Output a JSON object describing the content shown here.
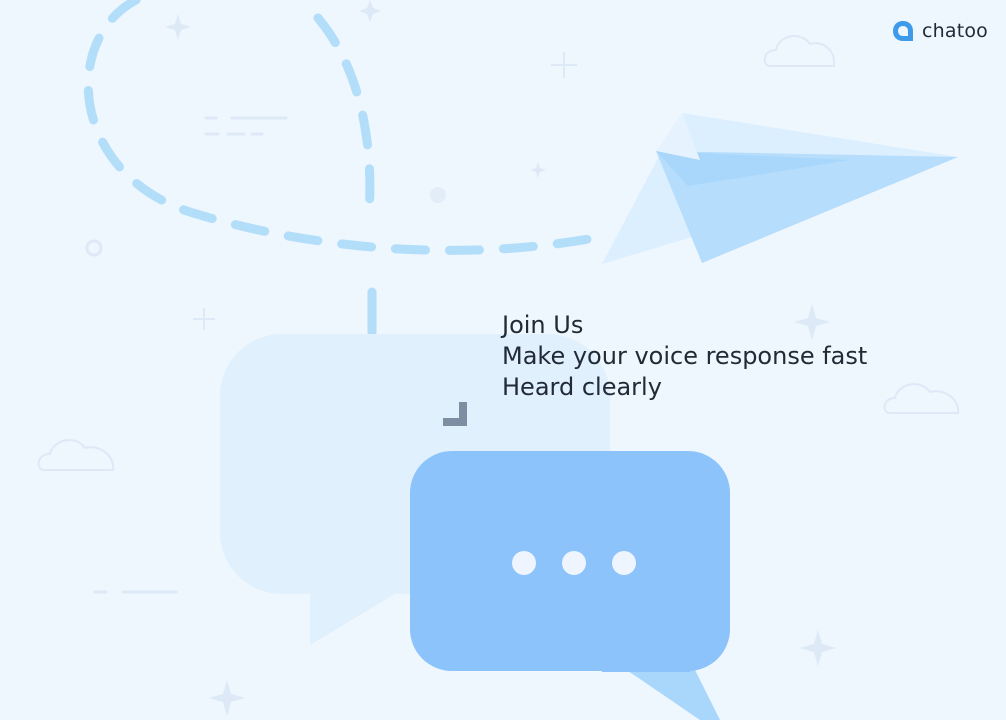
{
  "brand": {
    "name": "chatoo",
    "icon": "chat-bubble-logo-icon",
    "color": "#3d9be9"
  },
  "hero": {
    "lines": [
      "Join Us",
      "Make your voice response fast",
      "Heard clearly"
    ]
  },
  "illustration": {
    "icons": [
      "paper-plane-icon",
      "chat-bubble-icon",
      "typing-dots-icon",
      "cloud-icon",
      "sparkle-icon"
    ],
    "colors": {
      "background": "#eef6fe",
      "dashed_path": "#b3defa",
      "bubble_back": "#e0f0fd",
      "bubble_front": "#8cc3fb",
      "bubble_tail": "#a9d6fb",
      "plane_light": "#dcefff",
      "plane_dark": "#b6ddfb"
    }
  }
}
